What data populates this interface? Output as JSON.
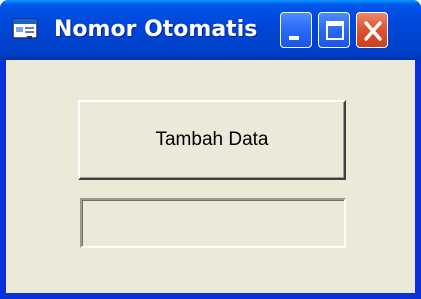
{
  "window": {
    "title": "Nomor Otomatis",
    "icon": "form-window-icon",
    "controls": [
      "minimize-icon",
      "maximize-icon",
      "close-icon"
    ]
  },
  "form": {
    "button_label": "Tambah Data",
    "textbox_value": ""
  },
  "colors": {
    "titlebar": "#0047d8",
    "client_background": "#ece9d8",
    "close_button": "#dd5533",
    "caption_button": "#2b6cf5"
  }
}
